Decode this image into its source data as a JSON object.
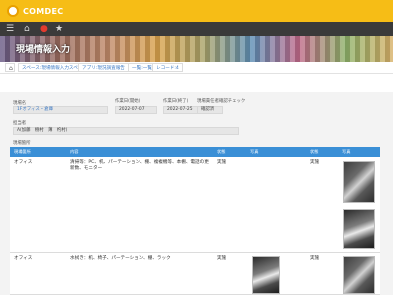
{
  "app": {
    "logo_text": "COMDEC"
  },
  "iconbar": {
    "icons": [
      "menu-icon",
      "home-icon",
      "person-icon",
      "star-icon"
    ]
  },
  "banner": {
    "title": "現場情報入力"
  },
  "breadcrumb": {
    "items": [
      "スペース:現場情報入力スペース",
      "アプリ:現況調査報告",
      "一覧:一覧",
      "レコード:4"
    ]
  },
  "form": {
    "site_label": "現場名",
    "site_value": "1Fオフィス・倉庫",
    "start_label": "作業日(開始)",
    "start_value": "2022-07-07",
    "end_label": "作業日(終了)",
    "end_value": "2022-07-25",
    "check_label": "現場責任者確認チェック",
    "check_value": "確認済",
    "staff_label": "担当者",
    "staff_value": "A(加藤　樹村　薄　杓村)",
    "survey_label": "現場箇所"
  },
  "table": {
    "columns": [
      "現場箇所",
      "内容",
      "状態",
      "写真",
      "状態",
      "写真"
    ],
    "rows": [
      {
        "place": "オフィス",
        "content": "清掃等：PC、机、パーテーション、棚、複複機等、本棚、電話の更新数、モニター",
        "status": "実施",
        "status2": "実施"
      },
      {
        "place": "オフィス",
        "content": "水拭き：机、椅子、パーテーション、棚、ラック",
        "status": "実施",
        "status2": "実施"
      }
    ]
  },
  "colors": {
    "topbar": "#f6bd16",
    "iconbar": "#3a3a3a",
    "table_header": "#3a8fd6",
    "link": "#3a78c3"
  }
}
